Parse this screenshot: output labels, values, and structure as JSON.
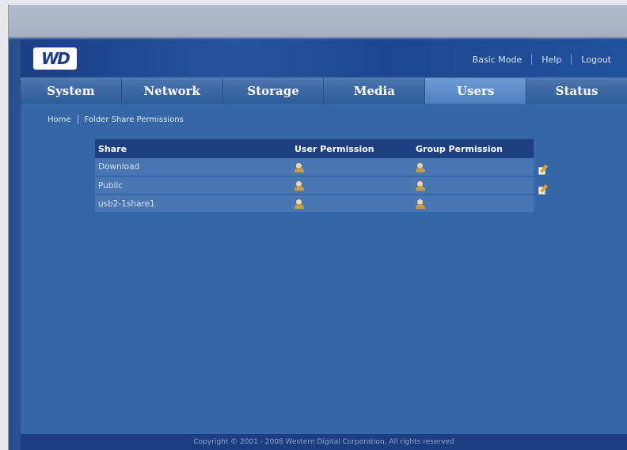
{
  "header": {
    "logo_text": "WD",
    "links": {
      "basic_mode": "Basic Mode",
      "help": "Help",
      "logout": "Logout"
    }
  },
  "tabs": [
    {
      "label": "System"
    },
    {
      "label": "Network"
    },
    {
      "label": "Storage"
    },
    {
      "label": "Media"
    },
    {
      "label": "Users",
      "active": true
    },
    {
      "label": "Status"
    }
  ],
  "breadcrumb": {
    "home": "Home",
    "current": "Folder Share Permissions"
  },
  "table": {
    "columns": [
      "Share",
      "User Permission",
      "Group Permission"
    ],
    "rows": [
      {
        "share": "Download",
        "user_icon": "user-icon",
        "group_icon": "user-icon",
        "edit": true
      },
      {
        "share": "Public",
        "user_icon": "user-icon",
        "group_icon": "user-icon",
        "edit": true
      },
      {
        "share": "usb2-1share1",
        "user_icon": "user-icon",
        "group_icon": "user-icon",
        "edit": false
      }
    ]
  },
  "footer": {
    "copyright": "Copyright © 2001 - 2008 Western Digital Corporation, All rights reserved"
  },
  "colors": {
    "brand": "#1d3f80",
    "content_bg": "#3567a6",
    "active_tab": "#5f8cc9"
  }
}
